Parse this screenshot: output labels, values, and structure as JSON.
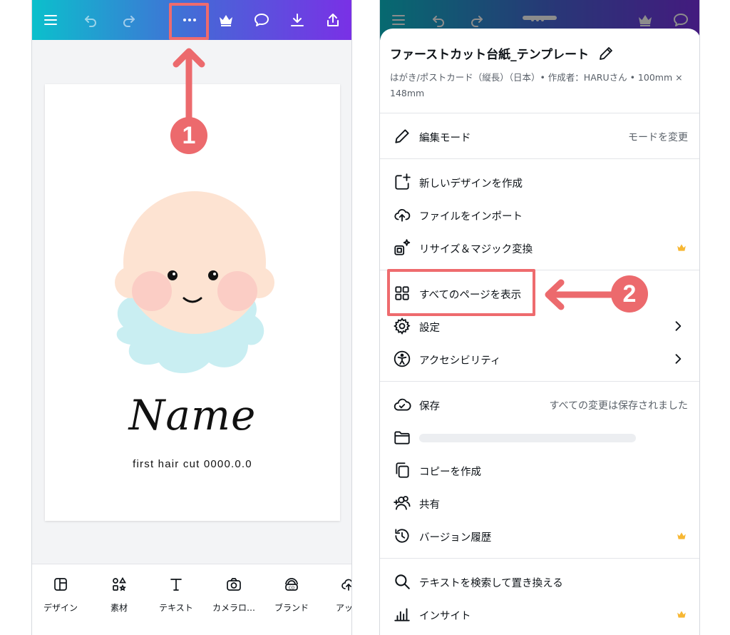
{
  "left_phone": {
    "canvas": {
      "name_text": "Name",
      "caption_text": "first hair cut  0000.0.0"
    },
    "bottom_tools": [
      {
        "label": "デザイン",
        "icon": "design-icon"
      },
      {
        "label": "素材",
        "icon": "elements-icon"
      },
      {
        "label": "テキスト",
        "icon": "text-icon"
      },
      {
        "label": "カメラロ…",
        "icon": "camera-icon"
      },
      {
        "label": "ブランド",
        "icon": "brand-icon"
      },
      {
        "label": "アップ",
        "icon": "upload-cloud-icon"
      }
    ],
    "annotation_number": "1"
  },
  "right_phone": {
    "sheet": {
      "title": "ファーストカット台紙_テンプレート",
      "subtitle": "はがき/ポストカード（縦長）（日本）• 作成者：HARUさん • 100mm × 148mm"
    },
    "menu": {
      "edit_mode": {
        "label": "編集モード",
        "right": "モードを変更"
      },
      "new_design": "新しいデザインを作成",
      "import_file": "ファイルをインポート",
      "resize": "リサイズ＆マジック変換",
      "view_all_pages": "すべてのページを表示",
      "settings": "設定",
      "accessibility": "アクセシビリティ",
      "save": {
        "label": "保存",
        "right": "すべての変更は保存されました"
      },
      "copy": "コピーを作成",
      "share": "共有",
      "version_history": "バージョン履歴",
      "find_replace": "テキストを検索して置き換える",
      "insights": "インサイト"
    },
    "annotation_number": "2"
  },
  "colors": {
    "annotation_red": "#ec6a6d",
    "premium_crown": "#f7b733",
    "topbar_start": "#0bc0cc",
    "topbar_end": "#7a30e6"
  }
}
